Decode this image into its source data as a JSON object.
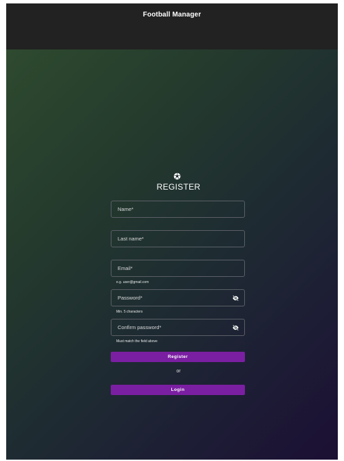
{
  "app": {
    "title": "Football Manager"
  },
  "form": {
    "logo_icon": "football-icon",
    "title": "REGISTER",
    "fields": {
      "name": {
        "label": "Name",
        "required_mark": "*",
        "value": ""
      },
      "last_name": {
        "label": "Last name",
        "required_mark": "*",
        "value": ""
      },
      "email": {
        "label": "Email",
        "required_mark": "*",
        "value": "",
        "hint": "e.g. user@gmail.com"
      },
      "password": {
        "label": "Password",
        "required_mark": "*",
        "value": "",
        "hint": "Min. 5 characters",
        "toggle_icon": "eye-off-icon"
      },
      "confirm_password": {
        "label": "Confirm password",
        "required_mark": "*",
        "value": "",
        "hint": "Must match the field above",
        "toggle_icon": "eye-off-icon"
      }
    },
    "register_label": "Register",
    "or_label": "or",
    "login_label": "Login"
  },
  "colors": {
    "topbar": "#222222",
    "button": "#7b1fa2",
    "gradient_start": "#2e4a2f",
    "gradient_end": "#1c0f33"
  }
}
